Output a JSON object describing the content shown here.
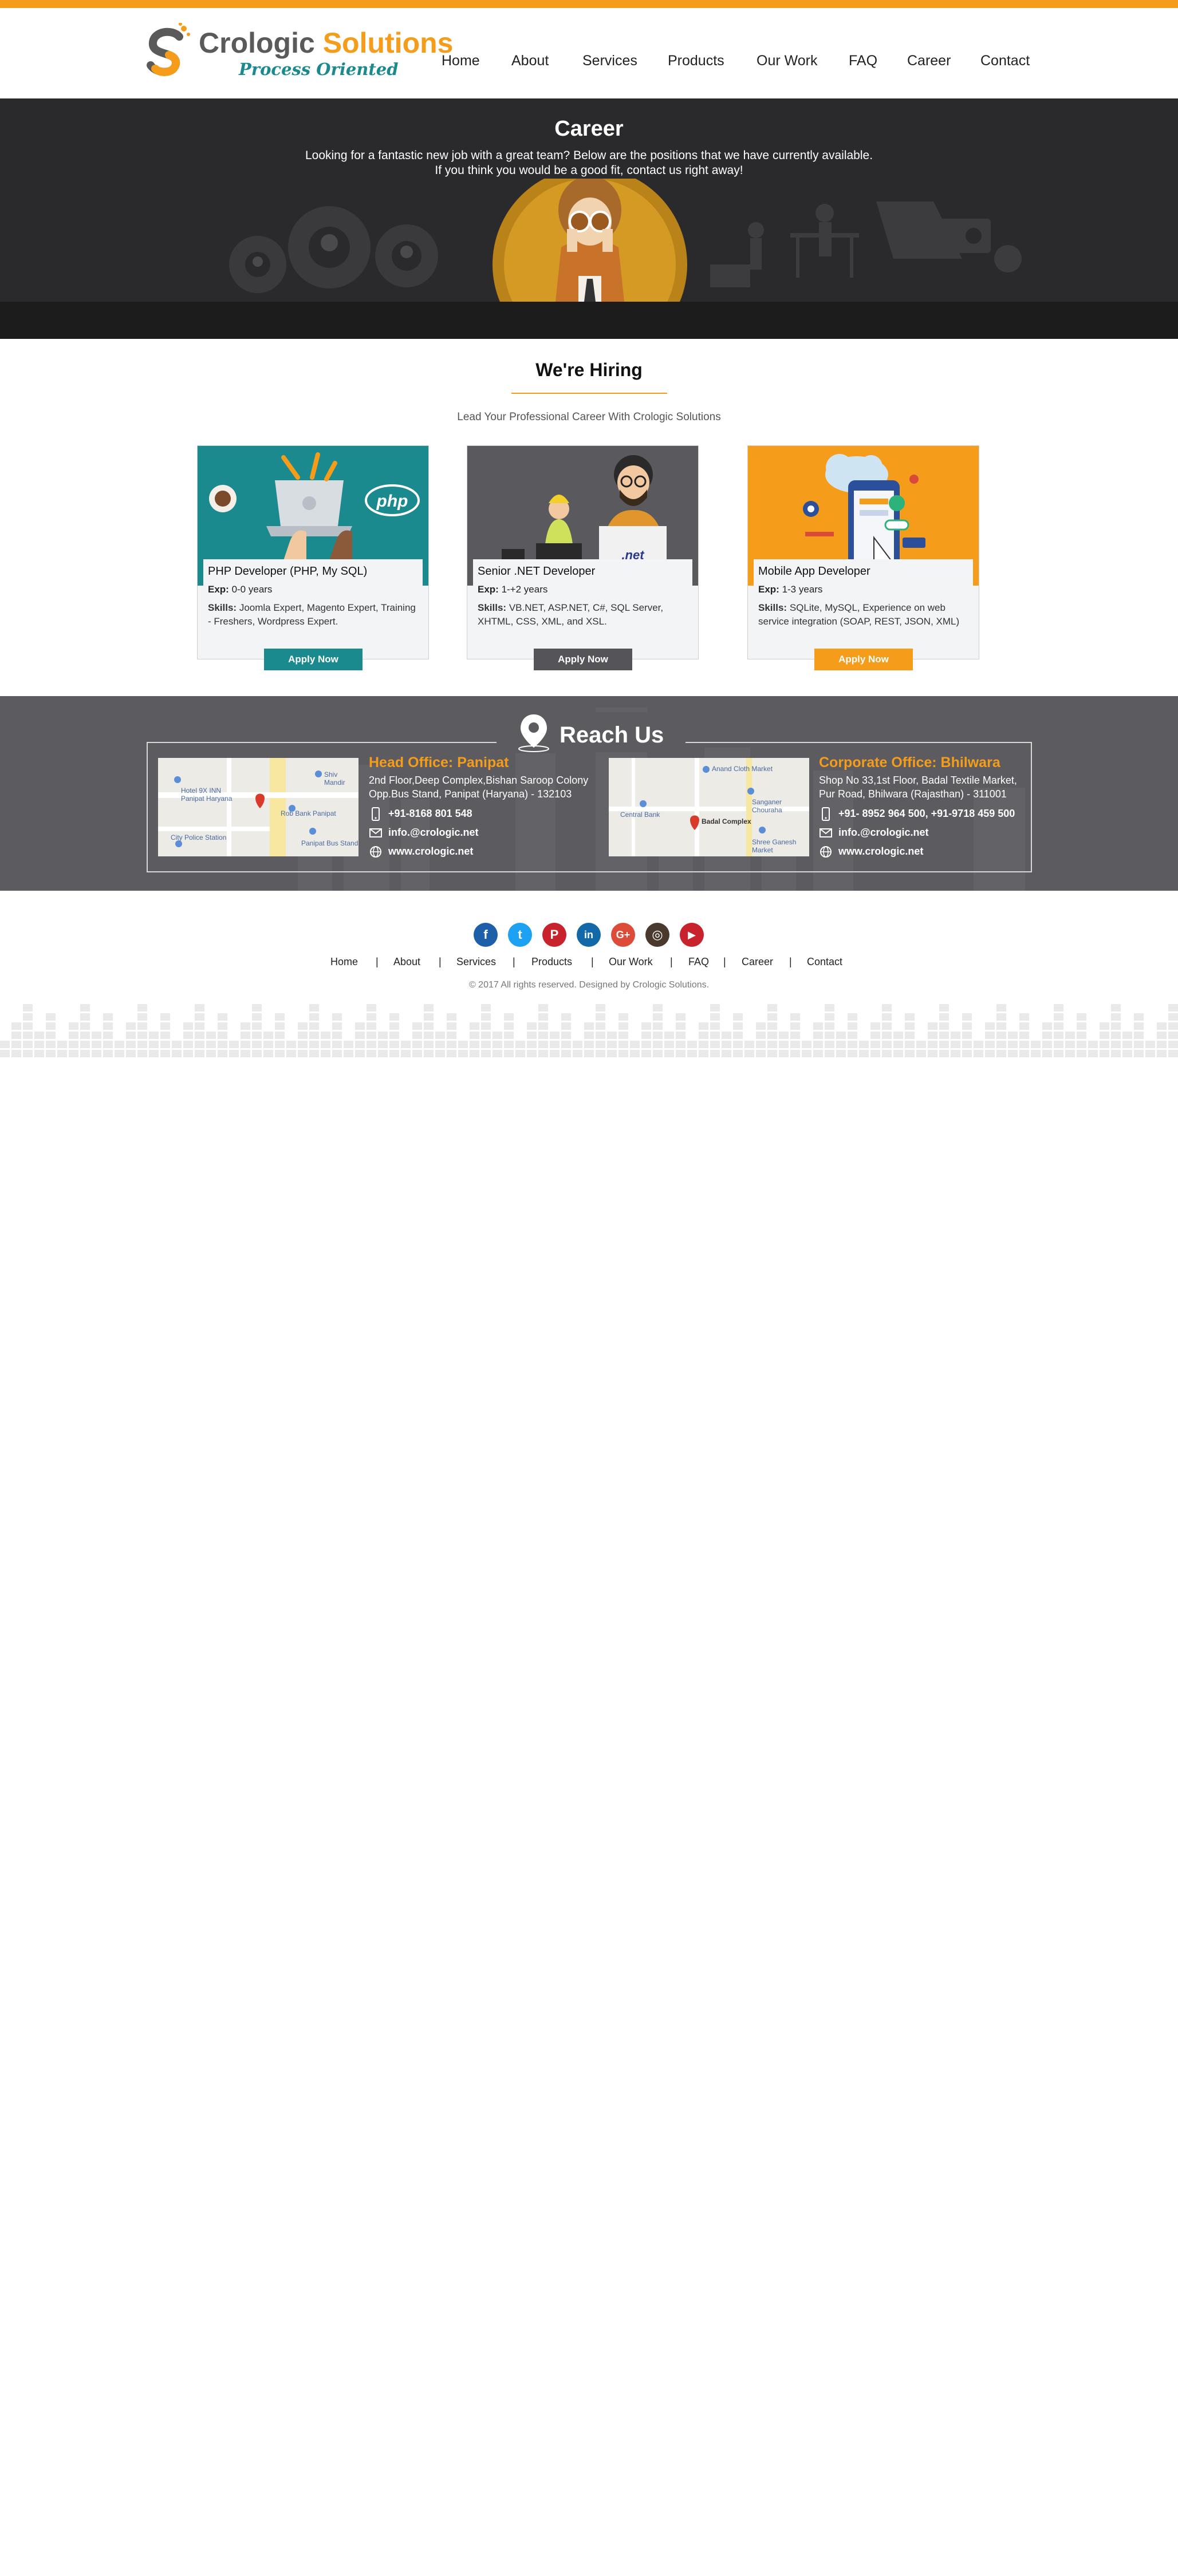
{
  "brand": {
    "name_part1": "Crologic",
    "name_part2": "Solutions",
    "tagline": "Process Oriented",
    "colors": {
      "accent": "#f59c1a",
      "teal": "#1b8a8e",
      "dark": "#2a2a2c",
      "gray_section": "#5b5b60",
      "gray_button": "#555559"
    }
  },
  "nav": {
    "items": [
      "Home",
      "About",
      "Services",
      "Products",
      "Our Work",
      "FAQ",
      "Career",
      "Contact"
    ]
  },
  "banner": {
    "title": "Career",
    "line1": "Looking for a fantastic new job with a great team?  Below are the positions that we have currently available.",
    "line2": "If you think you would be a good fit, contact us right away!"
  },
  "hiring": {
    "title": "We're Hiring",
    "subtitle": "Lead Your Professional Career With Crologic Solutions",
    "jobs": [
      {
        "title": "PHP Developer (PHP, My SQL)",
        "exp_label": "Exp:",
        "exp": " 0-0 years",
        "skills_label": "Skills:",
        "skills": " Joomla Expert, Magento Expert, Training - Freshers, Wordpress Expert.",
        "button": "Apply Now",
        "image_text": "php",
        "color": "#1b8a8e"
      },
      {
        "title": "Senior .NET Developer",
        "exp_label": "Exp:",
        "exp": " 1-+2 years",
        "skills_label": "Skills:",
        "skills": " VB.NET, ASP.NET, C#, SQL Server, XHTML, CSS, XML, and XSL.",
        "button": "Apply Now",
        "image_text": ".net",
        "color": "#555559"
      },
      {
        "title": "Mobile App Developer",
        "exp_label": "Exp:",
        "exp": " 1-3 years",
        "skills_label": "Skills:",
        "skills": " SQLite, MySQL, Experience on web service integration (SOAP, REST, JSON, XML)",
        "button": "Apply Now",
        "color": "#f59c1a"
      }
    ]
  },
  "reach": {
    "title": "Reach Us",
    "offices": [
      {
        "title": "Head Office: Panipat",
        "addr1": "2nd Floor,Deep Complex,Bishan Saroop Colony",
        "addr2": "Opp.Bus Stand, Panipat (Haryana) - 132103",
        "phone": "+91-8168 801 548",
        "email": "info.@crologic.net",
        "web": "www.crologic.net",
        "map_labels": [
          "Hotel 9X INN Panipat Haryana",
          "Shiv Mandir",
          "Rob Bank Panipat",
          "City Police Station",
          "Panipat Bus Stand"
        ]
      },
      {
        "title": "Corporate Office: Bhilwara",
        "addr1": "Shop No 33,1st Floor, Badal Textile Market,",
        "addr2": "Pur Road, Bhilwara (Rajasthan) - 311001",
        "phone": "+91- 8952 964 500, +91-9718 459 500",
        "email": "info.@crologic.net",
        "web": "www.crologic.net",
        "map_labels": [
          "Anand Cloth Market",
          "Sanganer Chouraha",
          "Central Bank",
          "Badal Complex",
          "Shree Ganesh Market"
        ]
      }
    ]
  },
  "footer": {
    "social": [
      {
        "name": "facebook-icon",
        "glyph": "f",
        "color": "#1d5fa8"
      },
      {
        "name": "twitter-icon",
        "glyph": "t",
        "color": "#1da1f2"
      },
      {
        "name": "pinterest-icon",
        "glyph": "P",
        "color": "#c8232c"
      },
      {
        "name": "linkedin-icon",
        "glyph": "in",
        "color": "#1369a8"
      },
      {
        "name": "googleplus-icon",
        "glyph": "G+",
        "color": "#dd4b39"
      },
      {
        "name": "instagram-icon",
        "glyph": "◎",
        "color": "#4a3a2e"
      },
      {
        "name": "youtube-icon",
        "glyph": "▶",
        "color": "#c8232c"
      }
    ],
    "links": [
      "Home",
      "About",
      "Services",
      "Products",
      "Our Work",
      "FAQ",
      "Career",
      "Contact"
    ],
    "copyright": "© 2017 All rights reserved. Designed by Crologic Solutions."
  }
}
